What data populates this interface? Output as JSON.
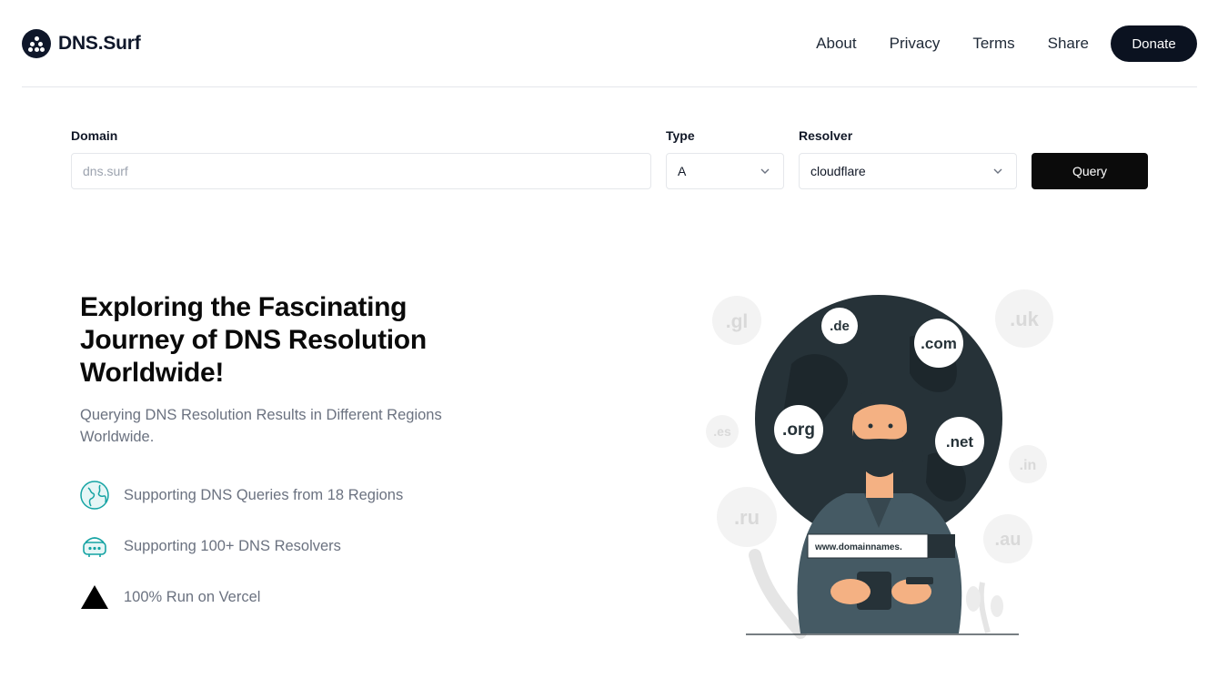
{
  "header": {
    "brand": "DNS.Surf",
    "nav": [
      "About",
      "Privacy",
      "Terms",
      "Share"
    ],
    "donate_label": "Donate"
  },
  "form": {
    "domain_label": "Domain",
    "domain_placeholder": "dns.surf",
    "type_label": "Type",
    "type_value": "A",
    "resolver_label": "Resolver",
    "resolver_value": "cloudflare",
    "query_label": "Query"
  },
  "hero": {
    "title": "Exploring the Fascinating Journey of DNS Resolution Worldwide!",
    "subtitle": "Querying DNS Resolution Results in Different Regions Worldwide.",
    "features": [
      {
        "icon": "globe-icon",
        "text": "Supporting DNS Queries from 18 Regions"
      },
      {
        "icon": "router-icon",
        "text": "Supporting 100+ DNS Resolvers"
      },
      {
        "icon": "vercel-triangle-icon",
        "text": "100% Run on Vercel"
      }
    ]
  },
  "illustration": {
    "tlds": [
      ".gl",
      ".de",
      ".com",
      ".uk",
      ".org",
      ".net",
      ".es",
      ".in",
      ".ru",
      ".au"
    ],
    "sign_text": "www.domainnames."
  },
  "colors": {
    "primary": "#0b1220",
    "accent_teal": "#14a3a3",
    "globe_dark": "#263238",
    "muted_text": "#6b7280"
  }
}
